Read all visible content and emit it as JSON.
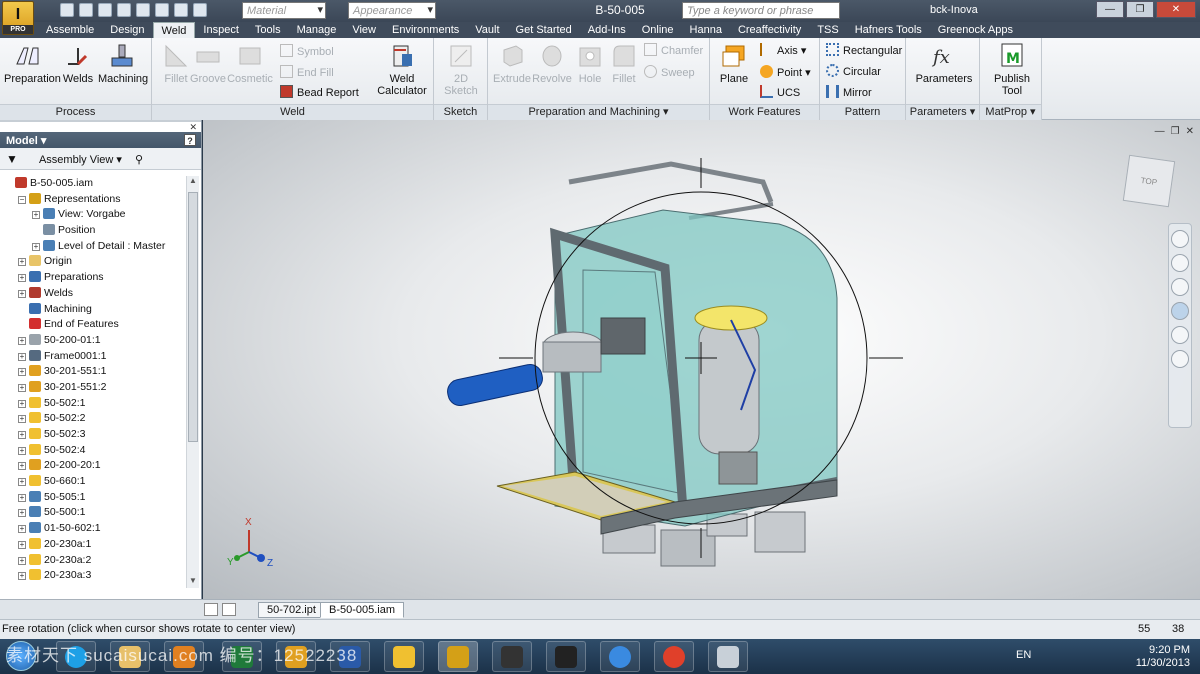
{
  "title_bar": {
    "logo_text": "I",
    "logo_sub": "PRO",
    "material_placeholder": "Material",
    "appearance_placeholder": "Appearance",
    "document_title": "B-50-005",
    "search_placeholder": "Type a keyword or phrase",
    "user": "bck-Inova"
  },
  "menu_tabs": [
    "Assemble",
    "Design",
    "Weld",
    "Inspect",
    "Tools",
    "Manage",
    "View",
    "Environments",
    "Vault",
    "Get Started",
    "Add-Ins",
    "Online",
    "Hanna",
    "Creaffectivity",
    "TSS",
    "Hafners Tools",
    "Greenock Apps"
  ],
  "active_tab": "Weld",
  "ribbon": {
    "process": {
      "label": "Process",
      "preparation": "Preparation",
      "welds": "Welds",
      "machining": "Machining"
    },
    "weld": {
      "label": "Weld",
      "fillet": "Fillet",
      "groove": "Groove",
      "cosmetic": "Cosmetic",
      "symbol": "Symbol",
      "end_fill": "End Fill",
      "bead_report": "Bead Report",
      "weld_calculator_1": "Weld",
      "weld_calculator_2": "Calculator"
    },
    "sketch": {
      "label": "Sketch",
      "sketch_2d": "2D Sketch"
    },
    "prep_machining": {
      "label": "Preparation and Machining",
      "extrude": "Extrude",
      "revolve": "Revolve",
      "hole": "Hole",
      "fillet": "Fillet",
      "chamfer": "Chamfer",
      "sweep": "Sweep"
    },
    "work_features": {
      "label": "Work Features",
      "plane": "Plane",
      "axis": "Axis",
      "point": "Point",
      "ucs": "UCS"
    },
    "pattern": {
      "label": "Pattern",
      "rectangular": "Rectangular",
      "circular": "Circular",
      "mirror": "Mirror"
    },
    "parameters": {
      "label": "Parameters",
      "button": "Parameters"
    },
    "matprop": {
      "label": "MatProp",
      "publish_1": "Publish",
      "publish_2": "Tool"
    }
  },
  "browser": {
    "title": "Model",
    "view_label": "Assembly View",
    "nodes": [
      {
        "text": "B-50-005.iam",
        "indent": 0,
        "pm": "",
        "color": "#c0392b"
      },
      {
        "text": "Representations",
        "indent": 1,
        "pm": "−",
        "color": "#d4a017"
      },
      {
        "text": "View: Vorgabe",
        "indent": 2,
        "pm": "+",
        "color": "#4a7fb5"
      },
      {
        "text": "Position",
        "indent": 2,
        "pm": "",
        "color": "#7a8fa3"
      },
      {
        "text": "Level of Detail : Master",
        "indent": 2,
        "pm": "+",
        "color": "#4a7fb5"
      },
      {
        "text": "Origin",
        "indent": 1,
        "pm": "+",
        "color": "#e8c468"
      },
      {
        "text": "Preparations",
        "indent": 1,
        "pm": "+",
        "color": "#3a6fb0"
      },
      {
        "text": "Welds",
        "indent": 1,
        "pm": "+",
        "color": "#b03a2e"
      },
      {
        "text": "Machining",
        "indent": 1,
        "pm": "",
        "color": "#3a6fb0"
      },
      {
        "text": "End of Features",
        "indent": 1,
        "pm": "",
        "color": "#d32f2f"
      },
      {
        "text": "50-200-01:1",
        "indent": 1,
        "pm": "+",
        "color": "#9aa3ab"
      },
      {
        "text": "Frame0001:1",
        "indent": 1,
        "pm": "+",
        "color": "#556a80"
      },
      {
        "text": "30-201-551:1",
        "indent": 1,
        "pm": "+",
        "color": "#e0a020"
      },
      {
        "text": "30-201-551:2",
        "indent": 1,
        "pm": "+",
        "color": "#e0a020"
      },
      {
        "text": "50-502:1",
        "indent": 1,
        "pm": "+",
        "color": "#f0c030"
      },
      {
        "text": "50-502:2",
        "indent": 1,
        "pm": "+",
        "color": "#f0c030"
      },
      {
        "text": "50-502:3",
        "indent": 1,
        "pm": "+",
        "color": "#f0c030"
      },
      {
        "text": "50-502:4",
        "indent": 1,
        "pm": "+",
        "color": "#f0c030"
      },
      {
        "text": "20-200-20:1",
        "indent": 1,
        "pm": "+",
        "color": "#e0a020"
      },
      {
        "text": "50-660:1",
        "indent": 1,
        "pm": "+",
        "color": "#f0c030"
      },
      {
        "text": "50-505:1",
        "indent": 1,
        "pm": "+",
        "color": "#4a7fb5"
      },
      {
        "text": "50-500:1",
        "indent": 1,
        "pm": "+",
        "color": "#4a7fb5"
      },
      {
        "text": "01-50-602:1",
        "indent": 1,
        "pm": "+",
        "color": "#4a7fb5"
      },
      {
        "text": "20-230a:1",
        "indent": 1,
        "pm": "+",
        "color": "#f0c030"
      },
      {
        "text": "20-230a:2",
        "indent": 1,
        "pm": "+",
        "color": "#f0c030"
      },
      {
        "text": "20-230a:3",
        "indent": 1,
        "pm": "+",
        "color": "#f0c030"
      }
    ]
  },
  "viewport": {
    "viewcube_label": "TOP",
    "axis_x": "X",
    "axis_y": "Y",
    "axis_z": "Z"
  },
  "document_tabs": [
    "50-702.ipt",
    "B-50-005.iam"
  ],
  "active_document": "B-50-005.iam",
  "status": {
    "message": "Free rotation (click when cursor shows rotate to center view)",
    "count1": "55",
    "count2": "38"
  },
  "taskbar": {
    "lang": "EN",
    "time": "9:20 PM",
    "date": "11/30/2013"
  },
  "watermark": "素材天下 sucaisucai.com 编号：12522238",
  "colors": {
    "accent": "#3a6fb0",
    "ribbon_bg": "#eef1f4",
    "titlebar": "#3b4757"
  }
}
